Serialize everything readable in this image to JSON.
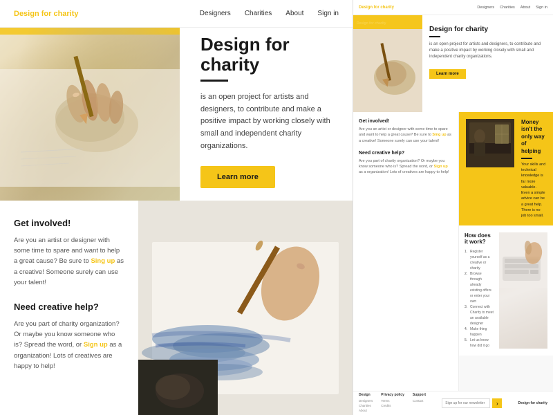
{
  "site": {
    "name": "Design for charity"
  },
  "nav": {
    "logo": "Design for charity",
    "links": [
      "Designers",
      "Charities",
      "About",
      "Sign in"
    ]
  },
  "hero": {
    "title": "Design for charity",
    "description": "is an open project for artists and designers, to contribute and make a positive impact by working closely with small and independent charity organizations.",
    "cta_label": "Learn more"
  },
  "get_involved": {
    "heading": "Get involved!",
    "text_part1": "Are you an artist or designer with some time to spare and want to help a great cause? Be sure to ",
    "link_text": "Sing up",
    "text_part2": " as a creative! Someone surely can use your talent!"
  },
  "need_help": {
    "heading": "Need creative help?",
    "text_part1": "Are you part of charity organization? Or maybe you know someone who is? Spread the word, or ",
    "link_text": "Sign up",
    "text_part2": " as a organization! Lots of creatives are happy to help!"
  },
  "highlight": {
    "title": "Money isn't the only way of helping",
    "text": "Your skills and technical knowledge is far more valuable. Even a simple advice can be a great help. There is no job too small."
  },
  "how_it_works": {
    "title": "How does it work?",
    "steps": [
      "Register yourself as a creative or charity",
      "Browse through already existing offers or enter your own",
      "Connect with Charity to meet an available designer",
      "Make thing happen",
      "Let us know how did it go"
    ]
  },
  "footer": {
    "cols": [
      {
        "title": "Design",
        "items": [
          "Designers",
          "Charities",
          "About"
        ]
      },
      {
        "title": "Privacy policy",
        "items": [
          "Terms",
          "Credits"
        ]
      },
      {
        "title": "Support",
        "items": [
          "Contact"
        ]
      }
    ],
    "newsletter_placeholder": "Sign up for our newsletter",
    "brand": "Design for charity"
  },
  "mini": {
    "nav_links": [
      "Designers",
      "Charities",
      "About",
      "Sign in"
    ],
    "get_involved_mini": "Are you an artist or designer with spare time and want to help a great cause? Be sure to Sign up as a creative! Someone surely can use your talent!",
    "need_help_mini": "Are you part of a charity organization? Or maybe you know someone who is? Spread the word, or Sign up as an organization! Lots of creatives are happy to help!"
  }
}
